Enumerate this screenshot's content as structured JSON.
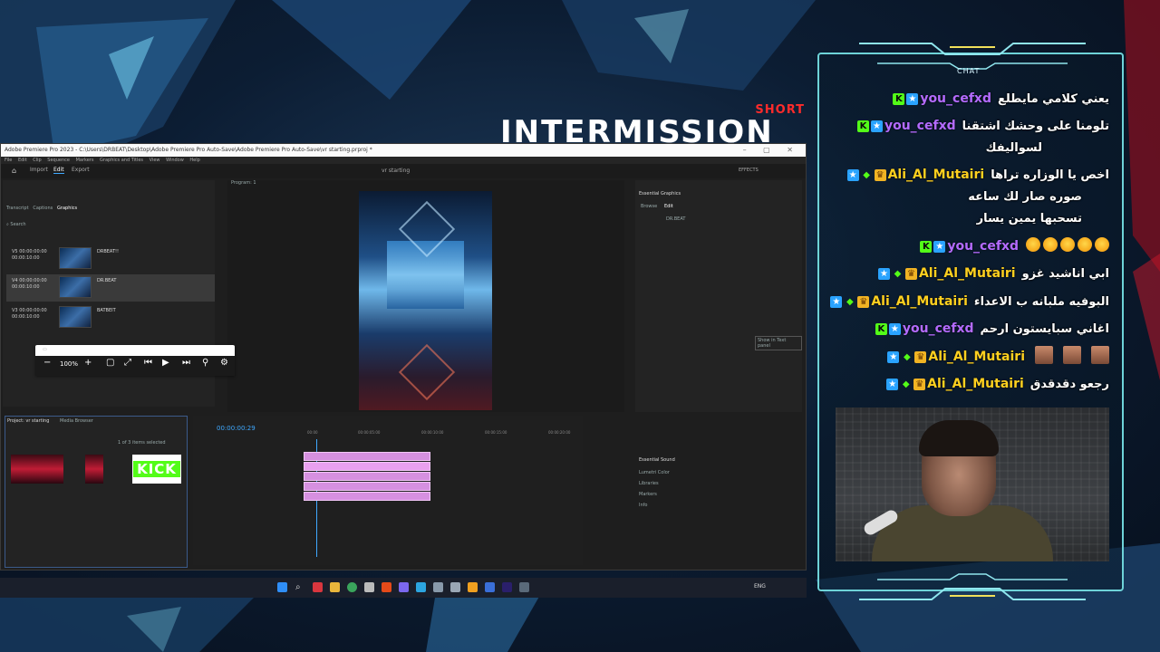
{
  "banner": {
    "tag": "SHORT",
    "title": "INTERMISSION"
  },
  "premiere": {
    "window_title": "Adobe Premiere Pro 2023 - C:\\Users\\DRBEAT\\Desktop\\Adobe Premiere Pro Auto-Save\\Adobe Premiere Pro Auto-Save\\vr starting.prproj *",
    "menus": [
      "File",
      "Edit",
      "Clip",
      "Sequence",
      "Markers",
      "Graphics and Titles",
      "View",
      "Window",
      "Help"
    ],
    "top_tabs": [
      "Import",
      "Edit",
      "Export"
    ],
    "project_name": "vr starting",
    "effects_label": "EFFECTS",
    "left_panel_tabs": [
      "Transcript",
      "Captions",
      "Graphics"
    ],
    "search_placeholder": "Search",
    "graphics_items": [
      {
        "track": "V5",
        "tc_in": "00:00:00:00",
        "tc_out": "00:00:10:00",
        "name": "DRBEAT!!"
      },
      {
        "track": "V4",
        "tc_in": "00:00:00:00",
        "tc_out": "00:00:10:00",
        "name": "DR.BEAT"
      },
      {
        "track": "V3",
        "tc_in": "00:00:00:00",
        "tc_out": "00:00:10:00",
        "name": "BATBEIT"
      }
    ],
    "program_label": "Program: 1",
    "essential_graphics": "Essential Graphics",
    "eg_tabs": [
      "Browse",
      "Edit"
    ],
    "eg_layer": "DR.BEAT",
    "show_in_text_panel": "Show in Text panel",
    "floating_zoom": "100%",
    "project_tabs": [
      "Project: vr starting",
      "Media Browser"
    ],
    "items_selected": "1 of 3 items selected",
    "kick_logo": "KICK",
    "timecode": "00:00:00:29",
    "ruler": [
      "00:00",
      "00:00:05:00",
      "00:00:10:00",
      "00:00:15:00",
      "00:00:20:00"
    ],
    "essential_sound": "Essential Sound",
    "right_lower_items": [
      "Lumetri Color",
      "Libraries",
      "Markers",
      "Info"
    ]
  },
  "chat": {
    "title": "CHAT",
    "messages": [
      {
        "user": "you_cefxd",
        "color": "#b46bff",
        "badges": [
          "K",
          "star"
        ],
        "text": "يعني كلامي مايطلع"
      },
      {
        "user": "you_cefxd",
        "color": "#b46bff",
        "badges": [
          "K",
          "star"
        ],
        "text": "تلومنا على وحشك اشتقنا",
        "cont": "لسواليفك"
      },
      {
        "user": "Ali_Al_Mutairi",
        "color": "#ffd01f",
        "badges": [
          "star",
          "green",
          "crown"
        ],
        "text": "اخص يا الوزاره تراها",
        "cont": [
          "صوره صار لك ساعه",
          "تسحبها يمين يسار"
        ]
      },
      {
        "user": "you_cefxd",
        "color": "#b46bff",
        "badges": [
          "K",
          "star"
        ],
        "text": "",
        "emotes": 5
      },
      {
        "user": "Ali_Al_Mutairi",
        "color": "#ffd01f",
        "badges": [
          "star",
          "green",
          "crown"
        ],
        "text": "ابي اناشيد غزو"
      },
      {
        "user": "Ali_Al_Mutairi",
        "color": "#ffd01f",
        "badges": [
          "star",
          "green",
          "crown"
        ],
        "text": "البوفيه ملبانه ب الاعداء"
      },
      {
        "user": "you_cefxd",
        "color": "#b46bff",
        "badges": [
          "K",
          "star"
        ],
        "text": "اغاني سبايستون ارحم"
      },
      {
        "user": "Ali_Al_Mutairi",
        "color": "#ffd01f",
        "badges": [
          "star",
          "green",
          "crown"
        ],
        "text": "",
        "pictures": 3
      },
      {
        "user": "Ali_Al_Mutairi",
        "color": "#ffd01f",
        "badges": [
          "star",
          "green",
          "crown"
        ],
        "text": "رجعو دقدقدق"
      }
    ]
  },
  "taskbar": {
    "lang": "ENG"
  }
}
